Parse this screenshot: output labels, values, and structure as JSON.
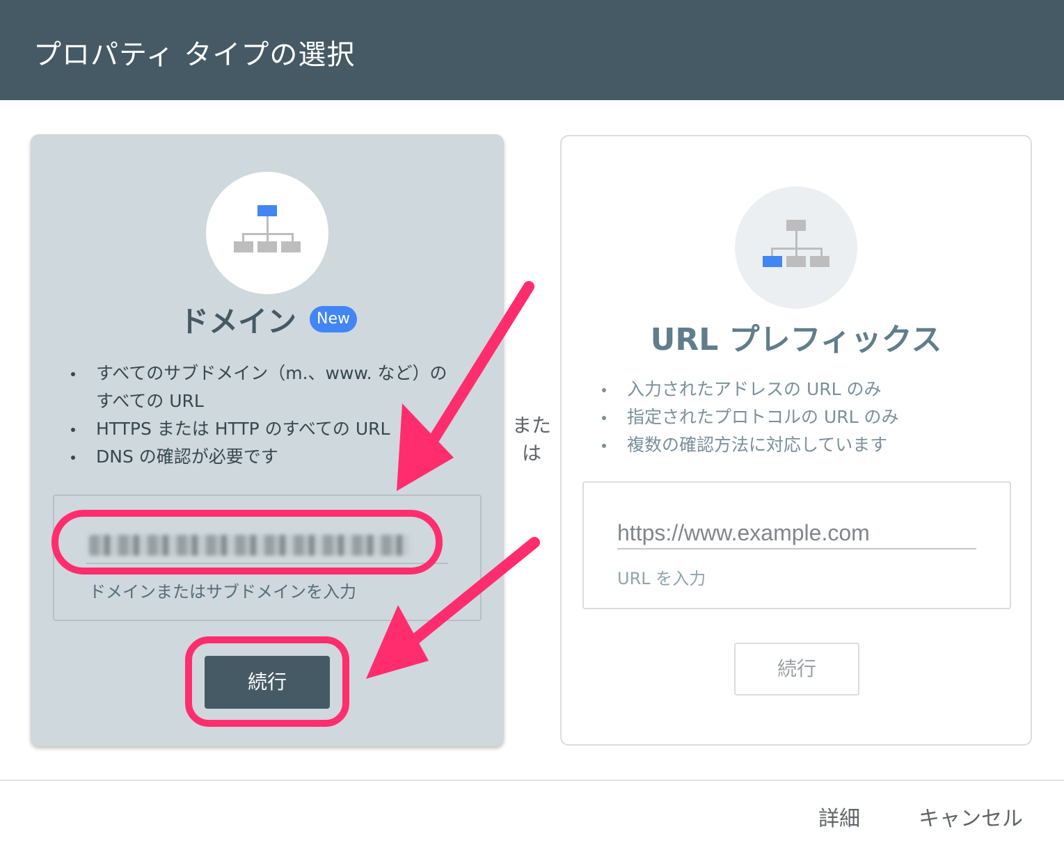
{
  "header": {
    "title": "プロパティ タイプの選択"
  },
  "domain_card": {
    "title": "ドメイン",
    "badge": "New",
    "bullets": [
      "すべてのサブドメイン（m.、www. など）の すべての URL",
      "HTTPS または HTTP のすべての URL",
      "DNS の確認が必要です"
    ],
    "input_helper": "ドメインまたはサブドメインを入力",
    "continue_label": "続行",
    "icon": "sitemap-icon"
  },
  "separator": {
    "label": "または"
  },
  "url_card": {
    "title": "URL プレフィックス",
    "bullets": [
      "入力されたアドレスの URL のみ",
      "指定されたプロトコルの URL のみ",
      "複数の確認方法に対応しています"
    ],
    "input_placeholder": "https://www.example.com",
    "input_helper": "URL を入力",
    "continue_label": "続行",
    "icon": "sitemap-icon"
  },
  "footer": {
    "details_label": "詳細",
    "cancel_label": "キャンセル"
  },
  "colors": {
    "header_bg": "#455a64",
    "domain_card_bg": "#cfd8dc",
    "accent_blue": "#4285f4",
    "highlight": "#ff2d6e"
  }
}
